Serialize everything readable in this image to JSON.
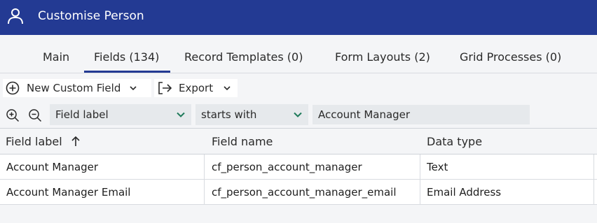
{
  "window": {
    "title": "Customise Person"
  },
  "tabs": [
    {
      "label": "Main"
    },
    {
      "label": "Fields (134)",
      "active": true
    },
    {
      "label": "Record Templates (0)"
    },
    {
      "label": "Form Layouts (2)"
    },
    {
      "label": "Grid Processes (0)"
    }
  ],
  "toolbar": {
    "new_custom_field": "New Custom Field",
    "export": "Export"
  },
  "filter": {
    "field": "Field label",
    "operator": "starts with",
    "value": "Account Manager"
  },
  "grid": {
    "columns": [
      "Field label",
      "Field name",
      "Data type"
    ],
    "sort_indicator": "ascending",
    "rows": [
      [
        "Account Manager",
        "cf_person_account_manager",
        "Text"
      ],
      [
        "Account Manager Email",
        "cf_person_account_manager_email",
        "Email Address"
      ]
    ]
  },
  "colors": {
    "accent": "#233a93",
    "chevron": "#1e7a5a"
  }
}
